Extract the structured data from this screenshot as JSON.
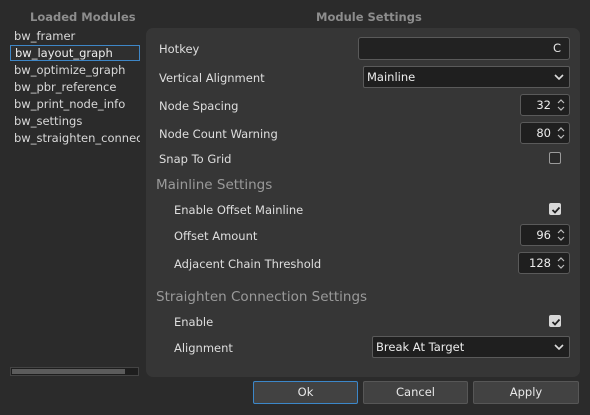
{
  "left_panel": {
    "header": "Loaded Modules",
    "modules": [
      {
        "label": "bw_framer",
        "selected": false
      },
      {
        "label": "bw_layout_graph",
        "selected": true
      },
      {
        "label": "bw_optimize_graph",
        "selected": false
      },
      {
        "label": "bw_pbr_reference",
        "selected": false
      },
      {
        "label": "bw_print_node_info",
        "selected": false
      },
      {
        "label": "bw_settings",
        "selected": false
      },
      {
        "label": "bw_straighten_connection",
        "selected": false
      }
    ]
  },
  "right_panel": {
    "header": "Module Settings",
    "hotkey": {
      "label": "Hotkey",
      "value": "C"
    },
    "vertical_alignment": {
      "label": "Vertical Alignment",
      "value": "Mainline"
    },
    "node_spacing": {
      "label": "Node Spacing",
      "value": "32"
    },
    "node_count_warning": {
      "label": "Node Count Warning",
      "value": "80"
    },
    "snap_to_grid": {
      "label": "Snap To Grid",
      "checked": false
    },
    "mainline_section": {
      "title": "Mainline Settings",
      "enable_offset": {
        "label": "Enable Offset Mainline",
        "checked": true
      },
      "offset_amount": {
        "label": "Offset Amount",
        "value": "96"
      },
      "adjacent_chain_threshold": {
        "label": "Adjacent Chain Threshold",
        "value": "128"
      }
    },
    "straighten_section": {
      "title": "Straighten Connection Settings",
      "enable": {
        "label": "Enable",
        "checked": true
      },
      "alignment": {
        "label": "Alignment",
        "value": "Break At Target"
      }
    }
  },
  "buttons": {
    "ok": "Ok",
    "cancel": "Cancel",
    "apply": "Apply"
  },
  "colors": {
    "background": "#2b2b2b",
    "panel": "#363636",
    "accent": "#3c87c9"
  }
}
